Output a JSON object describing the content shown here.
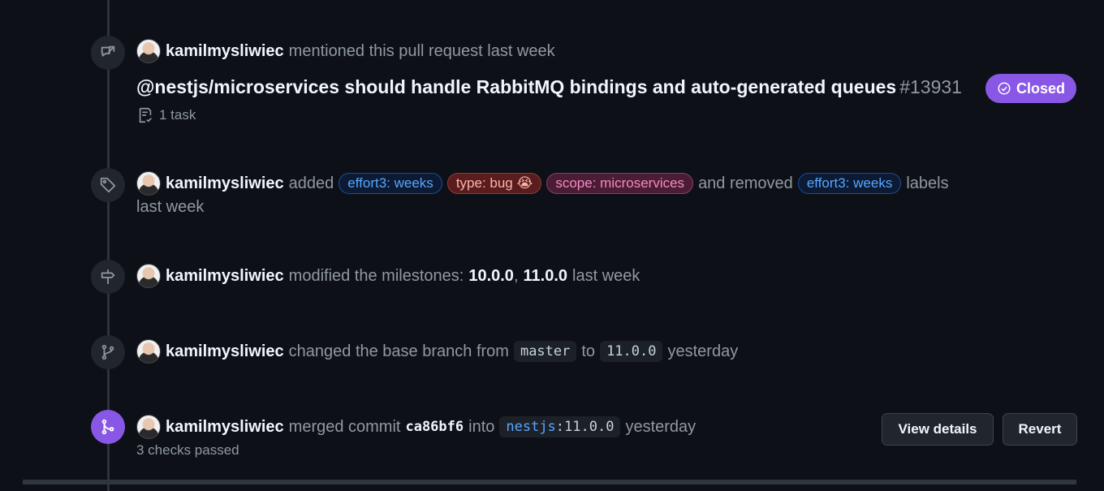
{
  "events": {
    "mention": {
      "author": "kamilmysliwiec",
      "text": "mentioned this pull request last week",
      "pr_title": "@nestjs/microservices should handle RabbitMQ bindings and auto-generated queues",
      "pr_number": "#13931",
      "status_label": "Closed",
      "task_text": "1 task"
    },
    "labels": {
      "author": "kamilmysliwiec",
      "added_text": "added",
      "added_labels": [
        "effort3: weeks",
        "type: bug 😭",
        "scope: microservices"
      ],
      "removed_text": "and removed",
      "removed_label": "effort3: weeks",
      "suffix": "labels",
      "time": "last week"
    },
    "milestone": {
      "author": "kamilmysliwiec",
      "text": "modified the milestones:",
      "from": "10.0.0",
      "sep": ",",
      "to": "11.0.0",
      "time": "last week"
    },
    "base": {
      "author": "kamilmysliwiec",
      "text": "changed the base branch from",
      "from": "master",
      "to_word": "to",
      "to": "11.0.0",
      "time": "yesterday"
    },
    "merge": {
      "author": "kamilmysliwiec",
      "text": "merged commit",
      "sha": "ca86bf6",
      "into": "into",
      "repo": "nestjs",
      "branch_sep": ":",
      "branch": "11.0.0",
      "time": "yesterday",
      "checks": "3 checks passed",
      "view_details": "View details",
      "revert": "Revert"
    }
  },
  "colors": {
    "background": "#0d1117",
    "merged_purple": "#8957e5",
    "label_blue": "#58a6ff"
  },
  "icons": [
    "cross-reference-icon",
    "tag-icon",
    "milestone-icon",
    "git-branch-icon",
    "git-merge-icon",
    "check-circle-icon",
    "task-list-icon"
  ]
}
